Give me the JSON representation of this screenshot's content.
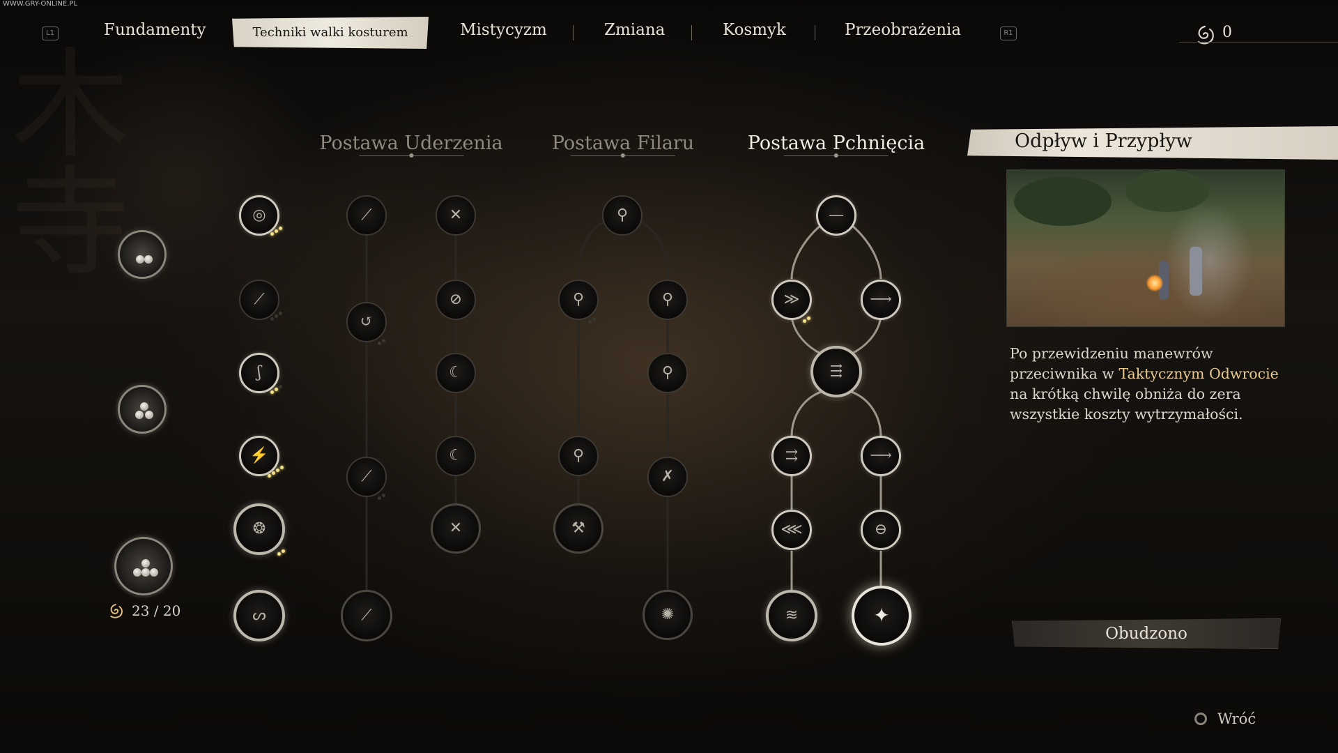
{
  "watermark": "WWW.GRY-ONLINE.PL",
  "nav": {
    "left_hint": "L1",
    "right_hint": "R1",
    "tabs": [
      {
        "label": "Fundamenty"
      },
      {
        "label": "Techniki walki kosturem"
      },
      {
        "label": "Mistycyzm"
      },
      {
        "label": "Zmiana"
      },
      {
        "label": "Kosmyk"
      },
      {
        "label": "Przeobrażenia"
      }
    ],
    "active_tab": "Techniki walki kosturem",
    "points": "0"
  },
  "columns": [
    {
      "title": "Postawa Uderzenia"
    },
    {
      "title": "Postawa Filaru"
    },
    {
      "title": "Postawa Pchnięcia"
    }
  ],
  "left": {
    "counter": "23 / 20"
  },
  "panel": {
    "title": "Odpływ i Przypływ",
    "desc_before": "Po przewidzeniu manewrów przeciwnika w ",
    "desc_highlight": "Taktycznym Odwrocie",
    "desc_after": " na krótką chwilę obniża do zera wszystkie koszty wytrzymałości.",
    "status": "Obudzono"
  },
  "footer": {
    "back_label": "Wróć"
  },
  "colors": {
    "accent_highlight": "#e9c98e",
    "unlocked_dot": "#f2e08a"
  }
}
